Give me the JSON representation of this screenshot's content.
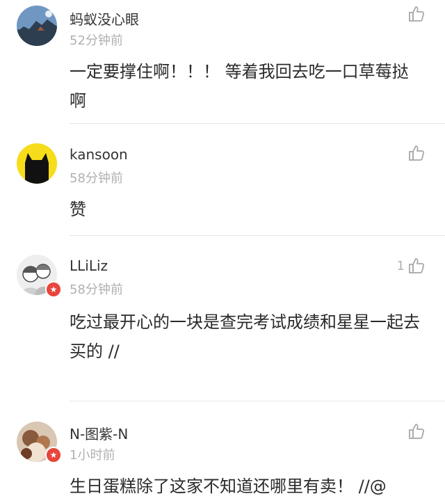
{
  "comments": [
    {
      "username": "蚂蚁没心眼",
      "time": "52分钟前",
      "text": "一定要撑住啊！！！ 等着我回去吃一口草莓挞啊",
      "likes": "",
      "avatar_icon": "landscape-avatar-icon",
      "verified": false
    },
    {
      "username": "kansoon",
      "time": "58分钟前",
      "text": "赞",
      "likes": "",
      "avatar_icon": "black-cat-avatar-icon",
      "verified": false
    },
    {
      "username": "LLiLiz",
      "time": "58分钟前",
      "text": "吃过最开心的一块是查完考试成绩和星星一起去买的 //",
      "likes": "1",
      "avatar_icon": "couple-drawing-avatar-icon",
      "verified": true
    },
    {
      "username": "N-图紫-N",
      "time": "1小时前",
      "text": "生日蛋糕除了这家不知道还哪里有卖！ //@",
      "likes": "",
      "avatar_icon": "photo-avatar-icon",
      "verified": true
    }
  ],
  "icons": {
    "like": "thumbs-up-icon",
    "verified": "star-badge-icon"
  },
  "colors": {
    "text": "#2a2a2a",
    "muted": "#b0b0b0",
    "badge": "#e8453c",
    "divider": "#e6e6e6"
  }
}
